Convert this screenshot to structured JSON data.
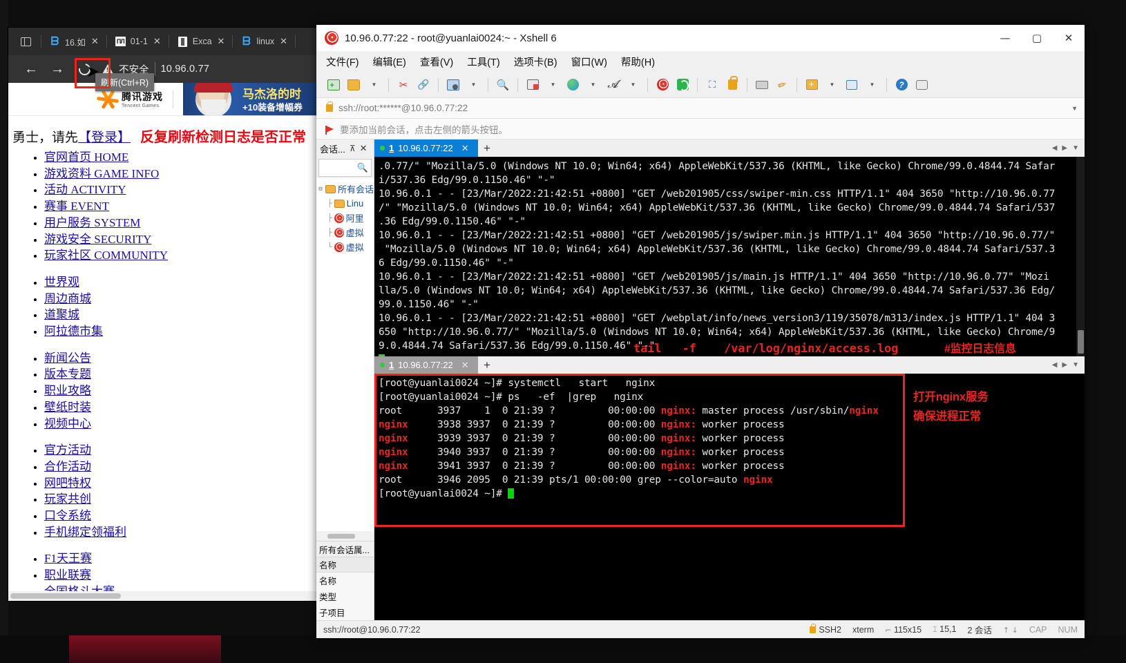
{
  "browser": {
    "tabs": [
      {
        "title": "16.如",
        "icon": "edge-icon"
      },
      {
        "title": "01-1",
        "icon": "book-icon"
      },
      {
        "title": "Exca",
        "icon": "doc-icon"
      },
      {
        "title": "linux",
        "icon": "edge-icon"
      }
    ],
    "back_label": "←",
    "forward_label": "→",
    "reload_tooltip": "刷新(Ctrl+R)",
    "security_label": "不安全",
    "url": "10.96.0.77",
    "banner": {
      "brand_cn": "腾讯游戏",
      "brand_en": "Tencent Games",
      "ad_line1": "马杰洛的时",
      "ad_line2": "+10装备增幅券"
    },
    "page": {
      "greeting_prefix": "勇士，请先",
      "login_link": "【登录】",
      "red_note": "反复刷新检测日志是否正常",
      "group1": [
        "官网首页 HOME",
        "游戏资料 GAME INFO",
        "活动 ACTIVITY",
        "赛事 EVENT",
        "用户服务 SYSTEM",
        "游戏安全 SECURITY",
        "玩家社区 COMMUNITY"
      ],
      "group2": [
        "世界观",
        "周边商城",
        "道聚城",
        "阿拉德市集"
      ],
      "group3": [
        "新闻公告",
        "版本专题",
        "职业攻略",
        "壁纸时装",
        "视频中心"
      ],
      "group4": [
        "官方活动",
        "合作活动",
        "网吧特权",
        "玩家共创",
        "口令系统",
        "手机绑定领福利"
      ],
      "group5": [
        "F1天王赛",
        "职业联赛",
        "全国格斗大赛"
      ]
    }
  },
  "xshell": {
    "window_title": "10.96.0.77:22 - root@yuanlai0024:~ - Xshell 6",
    "window_buttons": {
      "minimize": "—",
      "maximize": "▢",
      "close": "✕"
    },
    "menu": [
      "文件(F)",
      "编辑(E)",
      "查看(V)",
      "工具(T)",
      "选项卡(B)",
      "窗口(W)",
      "帮助(H)"
    ],
    "toolbar_icons": [
      "new-session-icon",
      "open-folder-icon",
      "open-folder-caret",
      "disconnect-icon",
      "reconnect-icon",
      "properties-icon",
      "properties-caret",
      "find-icon",
      "layout-icon",
      "layout-caret",
      "globe-icon",
      "globe-caret",
      "font-icon",
      "font-caret",
      "xshell-icon",
      "xftp-icon",
      "fullscreen-icon",
      "lock-icon",
      "keyboard-icon",
      "highlight-pen-icon",
      "add-icon",
      "add-caret",
      "grid-icon",
      "grid-caret",
      "help-icon",
      "chat-icon"
    ],
    "address": "ssh://root:******@10.96.0.77:22",
    "hint": "要添加当前会话，点击左侧的箭头按钮。",
    "session_panel": {
      "title": "会话...",
      "pin": "⊼",
      "close": "✕",
      "search_placeholder": "",
      "tree": [
        {
          "label": "所有会话",
          "icon": "folder-icon",
          "depth": 0
        },
        {
          "label": "Linu",
          "icon": "folder-icon",
          "depth": 1
        },
        {
          "label": "阿里",
          "icon": "xshell-icon",
          "depth": 1
        },
        {
          "label": "虚拟",
          "icon": "xshell-icon",
          "depth": 1
        },
        {
          "label": "虚拟",
          "icon": "xshell-icon",
          "depth": 1
        }
      ],
      "properties_title": "所有会话属...",
      "properties_header": "名称",
      "properties_rows": [
        "名称",
        "类型",
        "子项目"
      ]
    },
    "top_pane": {
      "tab": {
        "index": "1",
        "label": "10.96.0.77:22",
        "close": "✕",
        "new": "+"
      },
      "lines": [
        ".0.77/\" \"Mozilla/5.0 (Windows NT 10.0; Win64; x64) AppleWebKit/537.36 (KHTML, like Gecko) Chrome/99.0.4844.74 Safar",
        "i/537.36 Edg/99.0.1150.46\" \"-\"",
        "10.96.0.1 - - [23/Mar/2022:21:42:51 +0800] \"GET /web201905/css/swiper-min.css HTTP/1.1\" 404 3650 \"http://10.96.0.77",
        "/\" \"Mozilla/5.0 (Windows NT 10.0; Win64; x64) AppleWebKit/537.36 (KHTML, like Gecko) Chrome/99.0.4844.74 Safari/537",
        ".36 Edg/99.0.1150.46\" \"-\"",
        "10.96.0.1 - - [23/Mar/2022:21:42:51 +0800] \"GET /web201905/js/swiper.min.js HTTP/1.1\" 404 3650 \"http://10.96.0.77/\"",
        " \"Mozilla/5.0 (Windows NT 10.0; Win64; x64) AppleWebKit/537.36 (KHTML, like Gecko) Chrome/99.0.4844.74 Safari/537.3",
        "6 Edg/99.0.1150.46\" \"-\"",
        "10.96.0.1 - - [23/Mar/2022:21:42:51 +0800] \"GET /web201905/js/main.js HTTP/1.1\" 404 3650 \"http://10.96.0.77\" \"Mozi",
        "lla/5.0 (Windows NT 10.0; Win64; x64) AppleWebKit/537.36 (KHTML, like Gecko) Chrome/99.0.4844.74 Safari/537.36 Edg/",
        "99.0.1150.46\" \"-\"",
        "10.96.0.1 - - [23/Mar/2022:21:42:51 +0800] \"GET /webplat/info/news_version3/119/35078/m313/index.js HTTP/1.1\" 404 3",
        "650 \"http://10.96.0.77/\" \"Mozilla/5.0 (Windows NT 10.0; Win64; x64) AppleWebKit/537.36 (KHTML, like Gecko) Chrome/9",
        "9.0.4844.74 Safari/537.36 Edg/99.0.1150.46\" \"-\""
      ],
      "annotation_cmd": "tail   -f    /var/log/nginx/access.log",
      "annotation_note": "#监控日志信息"
    },
    "bottom_pane": {
      "tab": {
        "index": "1",
        "label": "10.96.0.77:22",
        "close": "✕",
        "new": "+"
      },
      "lines": [
        {
          "prompt": "[root@yuanlai0024 ~]# ",
          "cmd": "systemctl   start   nginx"
        },
        {
          "prompt": "[root@yuanlai0024 ~]# ",
          "cmd": "ps   -ef  |grep   nginx"
        }
      ],
      "processes": [
        {
          "user": "root",
          "pid": "3937",
          "ppid": "   1",
          "c": "0",
          "stime": "21:39",
          "tty": "?    ",
          "time": "00:00:00",
          "cmd_pre": "nginx:",
          "cmd_rest": " master process /usr/sbin/",
          "cmd_tail": "nginx",
          "user_red": false
        },
        {
          "user": "nginx",
          "pid": "3938",
          "ppid": "3937",
          "c": "0",
          "stime": "21:39",
          "tty": "?    ",
          "time": "00:00:00",
          "cmd_pre": "nginx:",
          "cmd_rest": " worker process",
          "cmd_tail": "",
          "user_red": true
        },
        {
          "user": "nginx",
          "pid": "3939",
          "ppid": "3937",
          "c": "0",
          "stime": "21:39",
          "tty": "?    ",
          "time": "00:00:00",
          "cmd_pre": "nginx:",
          "cmd_rest": " worker process",
          "cmd_tail": "",
          "user_red": true
        },
        {
          "user": "nginx",
          "pid": "3940",
          "ppid": "3937",
          "c": "0",
          "stime": "21:39",
          "tty": "?    ",
          "time": "00:00:00",
          "cmd_pre": "nginx:",
          "cmd_rest": " worker process",
          "cmd_tail": "",
          "user_red": true
        },
        {
          "user": "nginx",
          "pid": "3941",
          "ppid": "3937",
          "c": "0",
          "stime": "21:39",
          "tty": "?    ",
          "time": "00:00:00",
          "cmd_pre": "nginx:",
          "cmd_rest": " worker process",
          "cmd_tail": "",
          "user_red": true
        },
        {
          "user": "root",
          "pid": "3946",
          "ppid": "2095",
          "c": "0",
          "stime": "21:39",
          "tty": "pts/1",
          "time": "00:00:00",
          "cmd_pre": "grep",
          "cmd_rest": " --color=auto ",
          "cmd_tail": "nginx",
          "user_red": false
        }
      ],
      "final_prompt": "[root@yuanlai0024 ~]# ",
      "annotation_line1": "打开nginx服务",
      "annotation_line2": "确保进程正常"
    },
    "status": {
      "left": "ssh://root@10.96.0.77:22",
      "protocol": "SSH2",
      "term_type": "xterm",
      "size": "115x15",
      "cursor": "15,1",
      "sessions": "2 会话",
      "up": "↑",
      "down": "↓",
      "cap": "CAP",
      "num": "NUM"
    }
  },
  "colors": {
    "accent_blue": "#0b7fd4",
    "annotation_red": "#e8251f",
    "terminal_bg": "#000000",
    "terminal_fg": "#e6e6e6",
    "terminal_red": "#e8251f",
    "link_blue": "#1a0dab",
    "chrome_dark": "#333333"
  }
}
